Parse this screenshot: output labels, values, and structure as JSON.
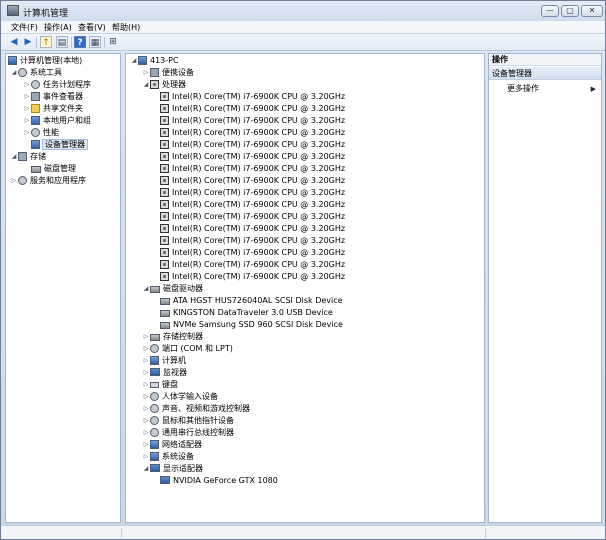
{
  "window": {
    "title": "计算机管理",
    "controls": {
      "minimize": "—",
      "maximize": "▢",
      "close": "✕"
    }
  },
  "menu": [
    "文件(F)",
    "操作(A)",
    "查看(V)",
    "帮助(H)"
  ],
  "toolbar_icons": [
    "back-arrow-icon",
    "forward-arrow-icon",
    "up-folder-icon",
    "show-hide-tree-icon",
    "help-icon",
    "properties-icon",
    "scan-hardware-icon"
  ],
  "left_tree": {
    "root": "计算机管理(本地)",
    "system_tools": "系统工具",
    "system_children": [
      "任务计划程序",
      "事件查看器",
      "共享文件夹",
      "本地用户和组",
      "性能",
      "设备管理器"
    ],
    "storage": "存储",
    "storage_children": [
      "磁盘管理"
    ],
    "services": "服务和应用程序"
  },
  "device_tree": {
    "computer": "413-PC",
    "portable": "便携设备",
    "processors_label": "处理器",
    "processors": [
      "Intel(R) Core(TM) i7-6900K CPU @ 3.20GHz",
      "Intel(R) Core(TM) i7-6900K CPU @ 3.20GHz",
      "Intel(R) Core(TM) i7-6900K CPU @ 3.20GHz",
      "Intel(R) Core(TM) i7-6900K CPU @ 3.20GHz",
      "Intel(R) Core(TM) i7-6900K CPU @ 3.20GHz",
      "Intel(R) Core(TM) i7-6900K CPU @ 3.20GHz",
      "Intel(R) Core(TM) i7-6900K CPU @ 3.20GHz",
      "Intel(R) Core(TM) i7-6900K CPU @ 3.20GHz",
      "Intel(R) Core(TM) i7-6900K CPU @ 3.20GHz",
      "Intel(R) Core(TM) i7-6900K CPU @ 3.20GHz",
      "Intel(R) Core(TM) i7-6900K CPU @ 3.20GHz",
      "Intel(R) Core(TM) i7-6900K CPU @ 3.20GHz",
      "Intel(R) Core(TM) i7-6900K CPU @ 3.20GHz",
      "Intel(R) Core(TM) i7-6900K CPU @ 3.20GHz",
      "Intel(R) Core(TM) i7-6900K CPU @ 3.20GHz",
      "Intel(R) Core(TM) i7-6900K CPU @ 3.20GHz"
    ],
    "disk_label": "磁盘驱动器",
    "disks": [
      "ATA HGST HUS726040AL SCSI Disk Device",
      "KINGSTON DataTraveler 3.0 USB Device",
      "NVMe Samsung SSD 960 SCSI Disk Device"
    ],
    "others": [
      "存储控制器",
      "端口 (COM 和 LPT)",
      "计算机",
      "监视器",
      "键盘",
      "人体学输入设备",
      "声音、视频和游戏控制器",
      "鼠标和其他指针设备",
      "通用串行总线控制器",
      "网络适配器",
      "系统设备"
    ],
    "display_label": "显示适配器",
    "gpu": "NVIDIA GeForce GTX 1080"
  },
  "actions": {
    "header": "操作",
    "section": "设备管理器",
    "more": "更多操作"
  }
}
